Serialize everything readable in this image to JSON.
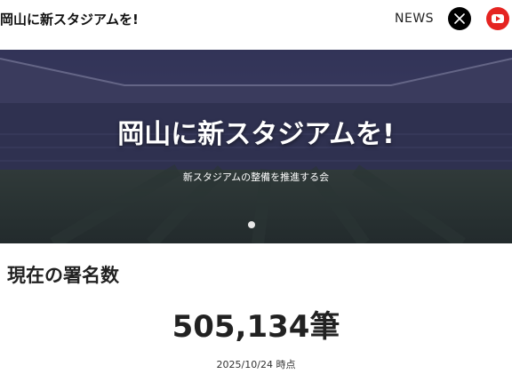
{
  "header": {
    "site_title": "岡山に新スタジアムを!",
    "nav_news": "NEWS",
    "x_icon": "x-logo-icon",
    "youtube_icon": "youtube-icon"
  },
  "hero": {
    "title": "岡山に新スタジアムを!",
    "subtitle": "新スタジアムの整備を推進する会"
  },
  "signatures": {
    "label": "現在の署名数",
    "count": "505,134筆",
    "as_of": "2025/10/24 時点"
  },
  "colors": {
    "hero_overlay": "#2a2d4a",
    "youtube_red": "#e52421",
    "x_black": "#000000"
  }
}
